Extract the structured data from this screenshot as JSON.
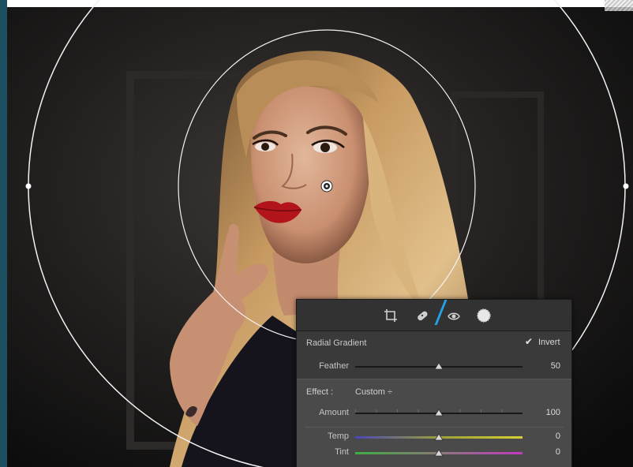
{
  "panel": {
    "tools": [
      {
        "icon": "crop-icon"
      },
      {
        "icon": "healing-brush-icon"
      },
      {
        "icon": "red-eye-icon"
      },
      {
        "icon": "radial-gradient-icon"
      }
    ],
    "title": "Radial Gradient",
    "invert_label": "Invert",
    "invert_checked": true,
    "feather": {
      "label": "Feather",
      "value": "50"
    },
    "effect": {
      "label": "Effect :",
      "preset": "Custom ÷"
    },
    "amount": {
      "label": "Amount",
      "value": "100"
    },
    "temp": {
      "label": "Temp",
      "value": "0"
    },
    "tint": {
      "label": "Tint",
      "value": "0"
    }
  },
  "colors": {
    "accent": "#23a4e6",
    "panel_bg": "#3a3a3a",
    "lip": "#b3141c"
  }
}
